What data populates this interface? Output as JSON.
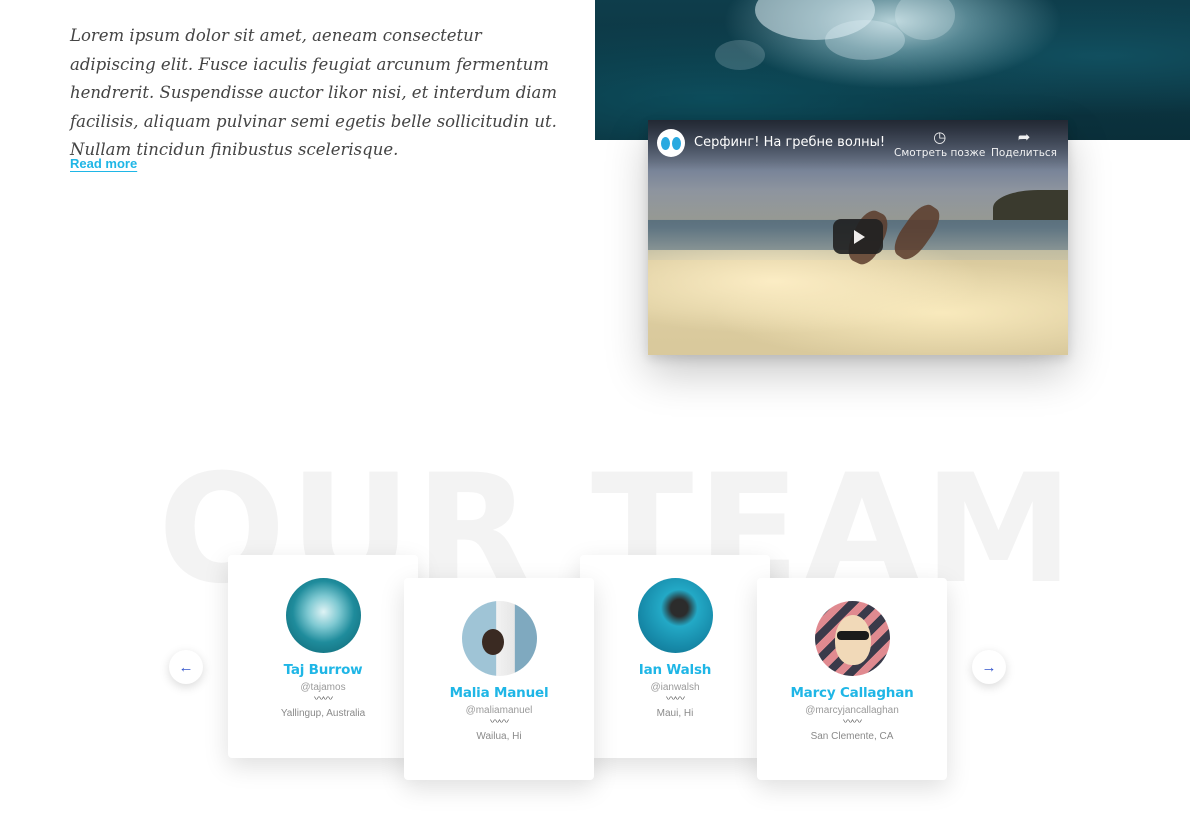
{
  "intro": {
    "text": "Lorem ipsum dolor sit amet, aeneam consectetur adipiscing elit. Fusce iaculis feugiat arcunum fermentum hendrerit. Suspendisse auctor likor nisi, et interdum diam facilisis, aliquam pulvinar semi egetis belle sollicitudin ut. Nullam tincidun finibustus scelerisque.",
    "read_more": "Read more"
  },
  "video": {
    "title": "Серфинг! На гребне волны!",
    "watch_later": "Смотреть позже",
    "share": "Поделиться",
    "watch_later_icon": "clock-icon",
    "share_icon": "share-arrow-icon",
    "play_icon": "play-icon"
  },
  "team": {
    "heading_bg": "OUR TEAM",
    "prev_icon": "arrow-left-icon",
    "next_icon": "arrow-right-icon",
    "squiggle": "〰〰",
    "members": [
      {
        "name": "Taj Burrow",
        "handle": "@tajamos",
        "location": "Yallingup, Australia"
      },
      {
        "name": "Malia Manuel",
        "handle": "@maliamanuel",
        "location": "Wailua, Hi"
      },
      {
        "name": "Ian Walsh",
        "handle": "@ianwalsh",
        "location": "Maui, Hi"
      },
      {
        "name": "Marcy Callaghan",
        "handle": "@marcyjancallaghan",
        "location": "San Clemente, CA"
      }
    ]
  },
  "colors": {
    "accent": "#1fb6e6",
    "arrow": "#3355cc",
    "heading_bg": "#f3f3f3"
  }
}
